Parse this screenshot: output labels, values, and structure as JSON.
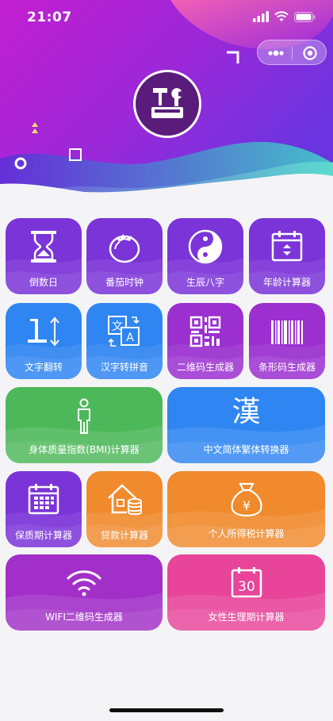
{
  "status_bar": {
    "time": "21:07"
  },
  "header": {
    "colors": {
      "magenta": "#c21fd0",
      "purple": "#7b2ee0",
      "pink": "#ff4fa0",
      "teal": "#3fd6c6"
    }
  },
  "tiles": [
    {
      "label": "倒数日",
      "icon": "hourglass-icon",
      "color": "#7b34d8"
    },
    {
      "label": "番茄时钟",
      "icon": "tomato-icon",
      "color": "#7b34d8"
    },
    {
      "label": "生辰八字",
      "icon": "yin-yang-icon",
      "color": "#7b34d8"
    },
    {
      "label": "年龄计算器",
      "icon": "calendar-icon",
      "color": "#7b34d8"
    },
    {
      "label": "文字翻转",
      "icon": "text-flip-icon",
      "color": "#2f86f2"
    },
    {
      "label": "汉字转拼音",
      "icon": "translate-icon",
      "color": "#2f86f2"
    },
    {
      "label": "二维码生成器",
      "icon": "qrcode-icon",
      "color": "#9b2fd0"
    },
    {
      "label": "条形码生成器",
      "icon": "barcode-icon",
      "color": "#9b2fd0"
    },
    {
      "label": "身体质量指数(BMI)计算器",
      "icon": "person-icon",
      "color": "#4db85a"
    },
    {
      "label": "中文简体繁体转换器",
      "icon": "han-character-icon",
      "color": "#2f86f2",
      "glyph": "漢"
    },
    {
      "label": "保质期计算器",
      "icon": "calendar-grid-icon",
      "color": "#7b34d8"
    },
    {
      "label": "贷款计算器",
      "icon": "house-coins-icon",
      "color": "#f08a2c"
    },
    {
      "label": "个人所得税计算器",
      "icon": "money-bag-icon",
      "color": "#f08a2c",
      "glyph": "¥"
    },
    {
      "label": "WIFI二维码生成器",
      "icon": "wifi-icon",
      "color": "#a22fc8"
    },
    {
      "label": "女性生理期计算器",
      "icon": "calendar-30-icon",
      "color": "#e8449a",
      "glyph": "30"
    }
  ]
}
